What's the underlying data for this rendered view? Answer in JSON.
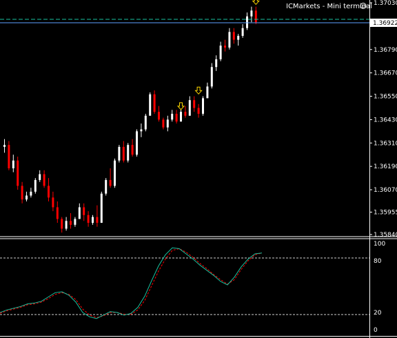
{
  "window": {
    "watermark": "ICMarkets - Mini terminal",
    "smiley_icon": "smiley-face-icon"
  },
  "colors": {
    "background": "#000000",
    "bull": "#ffffff",
    "bear": "#ff0000",
    "bid_line": "#5ea0ff",
    "ask_line": "#19c2a0",
    "stoch_main": "#19c2a0",
    "stoch_signal": "#ff0000",
    "arrow": "#ffd700",
    "grid": "#ffffff",
    "price_tag_bg": "#ffffff",
    "price_tag_fg": "#000000"
  },
  "price_axis": {
    "ticks": [
      "1.37030",
      "1.36790",
      "1.36670",
      "1.36550",
      "1.36430",
      "1.36310",
      "1.36190",
      "1.36070",
      "1.35955",
      "1.35840"
    ],
    "current_price": "1.36922"
  },
  "indicator": {
    "ticks": [
      "100",
      "80",
      "20",
      "0"
    ],
    "levels": [
      80,
      20
    ]
  },
  "chart_data": {
    "type": "candlestick",
    "price_range": [
      1.3584,
      1.3703
    ],
    "candles": [
      [
        1.3629,
        1.3633,
        1.3626,
        1.363
      ],
      [
        1.363,
        1.3632,
        1.3617,
        1.3618
      ],
      [
        1.3618,
        1.3625,
        1.3616,
        1.3622
      ],
      [
        1.3622,
        1.3624,
        1.3607,
        1.3609
      ],
      [
        1.3609,
        1.3611,
        1.36,
        1.3602
      ],
      [
        1.3602,
        1.3606,
        1.3601,
        1.3604
      ],
      [
        1.3604,
        1.3608,
        1.3603,
        1.3606
      ],
      [
        1.3606,
        1.3613,
        1.3605,
        1.3612
      ],
      [
        1.3612,
        1.3617,
        1.3611,
        1.3615
      ],
      [
        1.3615,
        1.3617,
        1.3608,
        1.3609
      ],
      [
        1.3609,
        1.3613,
        1.3601,
        1.3603
      ],
      [
        1.3603,
        1.3606,
        1.3596,
        1.3598
      ],
      [
        1.3598,
        1.3601,
        1.359,
        1.3592
      ],
      [
        1.3592,
        1.3593,
        1.3585,
        1.3587
      ],
      [
        1.3587,
        1.3593,
        1.3586,
        1.3591
      ],
      [
        1.3591,
        1.3595,
        1.3587,
        1.3589
      ],
      [
        1.3589,
        1.3593,
        1.3588,
        1.3592
      ],
      [
        1.3592,
        1.36,
        1.3592,
        1.3598
      ],
      [
        1.3598,
        1.36,
        1.3591,
        1.3594
      ],
      [
        1.3594,
        1.3596,
        1.3588,
        1.359
      ],
      [
        1.359,
        1.3594,
        1.3589,
        1.3593
      ],
      [
        1.3593,
        1.3599,
        1.3588,
        1.359
      ],
      [
        1.359,
        1.3606,
        1.359,
        1.3605
      ],
      [
        1.3605,
        1.3613,
        1.3604,
        1.3612
      ],
      [
        1.3612,
        1.3618,
        1.3608,
        1.3609
      ],
      [
        1.3609,
        1.3623,
        1.3608,
        1.3622
      ],
      [
        1.3622,
        1.363,
        1.3621,
        1.3629
      ],
      [
        1.3629,
        1.3632,
        1.3621,
        1.3622
      ],
      [
        1.3622,
        1.3631,
        1.3621,
        1.363
      ],
      [
        1.363,
        1.3633,
        1.3624,
        1.3625
      ],
      [
        1.3625,
        1.3638,
        1.3624,
        1.3637
      ],
      [
        1.3637,
        1.3641,
        1.3634,
        1.3638
      ],
      [
        1.3638,
        1.3646,
        1.3637,
        1.3645
      ],
      [
        1.3645,
        1.3657,
        1.3645,
        1.3656
      ],
      [
        1.3656,
        1.3658,
        1.3646,
        1.3647
      ],
      [
        1.3647,
        1.365,
        1.3642,
        1.3643
      ],
      [
        1.3643,
        1.3644,
        1.3638,
        1.3639
      ],
      [
        1.3639,
        1.3645,
        1.3637,
        1.3643
      ],
      [
        1.3643,
        1.3648,
        1.3642,
        1.3646
      ],
      [
        1.3646,
        1.3648,
        1.3641,
        1.3642
      ],
      [
        1.3642,
        1.3648,
        1.3642,
        1.3647
      ],
      [
        1.3647,
        1.365,
        1.3644,
        1.3645
      ],
      [
        1.3645,
        1.3655,
        1.3645,
        1.3653
      ],
      [
        1.3653,
        1.3655,
        1.3647,
        1.3649
      ],
      [
        1.3649,
        1.3651,
        1.3644,
        1.3646
      ],
      [
        1.3646,
        1.3655,
        1.3645,
        1.3654
      ],
      [
        1.3654,
        1.3662,
        1.3654,
        1.366
      ],
      [
        1.366,
        1.3672,
        1.3659,
        1.367
      ],
      [
        1.367,
        1.3676,
        1.3668,
        1.3674
      ],
      [
        1.3674,
        1.3683,
        1.3673,
        1.3681
      ],
      [
        1.3681,
        1.3684,
        1.3678,
        1.368
      ],
      [
        1.368,
        1.369,
        1.3679,
        1.3688
      ],
      [
        1.3688,
        1.369,
        1.3682,
        1.3684
      ],
      [
        1.3684,
        1.3687,
        1.3681,
        1.3686
      ],
      [
        1.3686,
        1.3692,
        1.3685,
        1.369
      ],
      [
        1.369,
        1.3698,
        1.3689,
        1.3696
      ],
      [
        1.3696,
        1.3701,
        1.3693,
        1.3699
      ],
      [
        1.3699,
        1.3701,
        1.3692,
        1.3693
      ]
    ],
    "arrows": [
      {
        "candle": 40,
        "price": 1.36485
      },
      {
        "candle": 44,
        "price": 1.36565
      },
      {
        "candle": 57,
        "price": 1.37025
      }
    ],
    "stochastic_main": [
      20,
      23,
      25,
      27,
      30,
      31,
      33,
      38,
      43,
      44,
      40,
      32,
      20,
      15,
      13,
      17,
      21,
      20,
      17,
      19,
      26,
      39,
      57,
      74,
      87,
      95,
      94,
      88,
      82,
      75,
      69,
      63,
      56,
      52,
      61,
      73,
      82,
      88,
      89
    ],
    "stochastic_signal": [
      19,
      22,
      24,
      26,
      29,
      30,
      32,
      36,
      41,
      43,
      41,
      35,
      24,
      17,
      14,
      16,
      20,
      20,
      18,
      18,
      23,
      34,
      51,
      68,
      82,
      92,
      94,
      90,
      84,
      77,
      71,
      64,
      58,
      53,
      58,
      70,
      80,
      87,
      89
    ]
  }
}
